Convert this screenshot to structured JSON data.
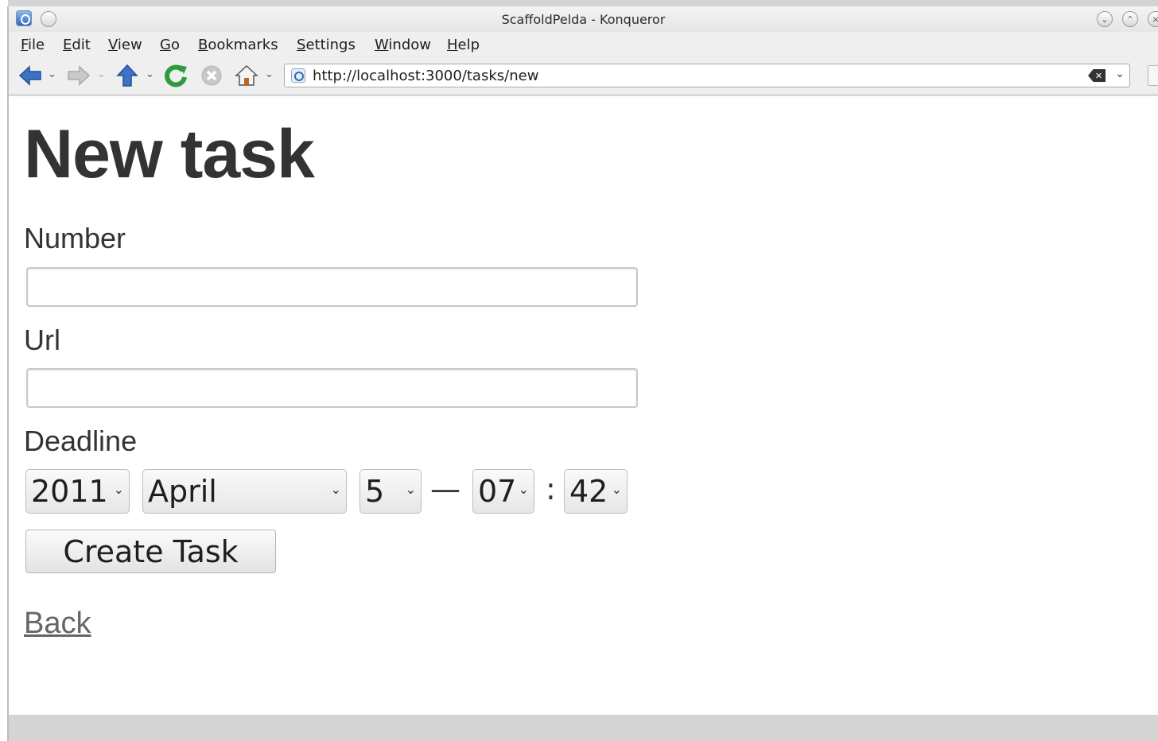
{
  "window": {
    "title": "ScaffoldPelda - Konqueror"
  },
  "menu": {
    "items": [
      "File",
      "Edit",
      "View",
      "Go",
      "Bookmarks",
      "Settings",
      "Window",
      "Help"
    ]
  },
  "toolbar": {
    "icons": [
      "back-arrow-icon",
      "forward-arrow-icon",
      "up-arrow-icon",
      "reload-icon",
      "stop-icon",
      "home-icon"
    ],
    "colors": {
      "nav_blue": "#3d73c4",
      "reload_green": "#2e9b3e",
      "stop_gray": "#b8b8b8"
    }
  },
  "address_bar": {
    "url": "http://localhost:3000/tasks/new"
  },
  "form": {
    "heading": "New task",
    "number_label": "Number",
    "number_value": "",
    "url_label": "Url",
    "url_value": "",
    "deadline_label": "Deadline",
    "deadline": {
      "year": "2011",
      "month": "April",
      "day": "5",
      "date_time_separator": "—",
      "hour": "07",
      "time_separator": ":",
      "minute": "42"
    },
    "submit_label": "Create Task",
    "back_link": "Back"
  }
}
